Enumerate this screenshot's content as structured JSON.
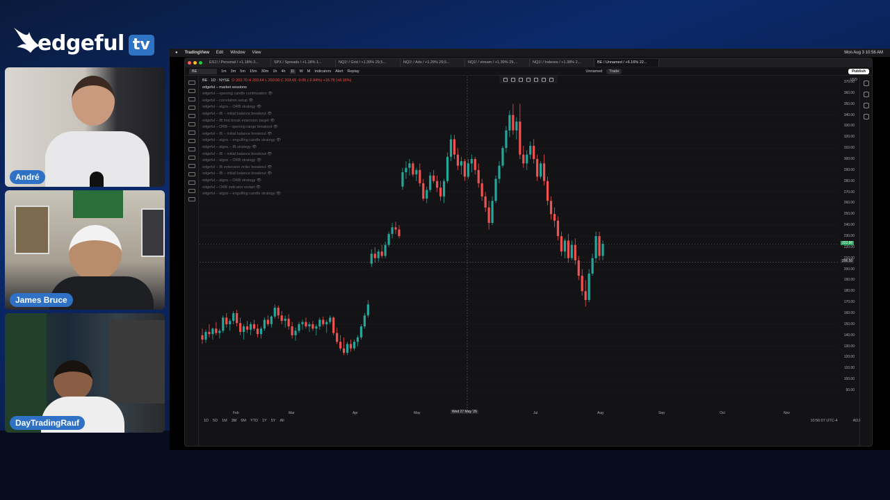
{
  "brand": {
    "word": "edgeful",
    "tv": "tv"
  },
  "participants": [
    {
      "name": "André"
    },
    {
      "name": "James Bruce"
    },
    {
      "name": "DayTradingRauf"
    }
  ],
  "mac_menu": {
    "app": "TradingView",
    "items": [
      "Edit",
      "Window",
      "View"
    ],
    "clock": "Mon Aug 3 10:56 AM"
  },
  "tabs": [
    {
      "label": "ES1! / Personal / +1.18% 3..."
    },
    {
      "label": "SPX / Spreads / +1.18% 1..."
    },
    {
      "label": "NQ1! / Grid / +1.39% 29,5..."
    },
    {
      "label": "NQ1! / Ads / +1.29% 29,5..."
    },
    {
      "label": "NQ1! / stream / +1.39% 29,..."
    },
    {
      "label": "NQ1! / Indexes / +1.38% 2..."
    },
    {
      "label": "BE / Unnamed / +6.16% 22..."
    }
  ],
  "toolbar": {
    "symbol": "BE",
    "intervals": [
      "1m",
      "3m",
      "5m",
      "15m",
      "30m",
      "1h",
      "4h",
      "D",
      "W",
      "M"
    ],
    "indicators": "Indicators",
    "alert": "Alert",
    "replay": "Replay",
    "layout": "Unnamed",
    "trade": "Trade",
    "publish": "Publish"
  },
  "legend": {
    "title": "BE · 1D · NYSE",
    "ohlc": "O 203.70  H 203.64  L 203.00  C 203.65  -0.05 (-2.94%)  +16.78 (+8.16%)",
    "first": "edgeful – market sessions",
    "indicators": [
      "edgeful – opening candle continuation",
      "edgeful – correlation setup",
      "edgeful – algos – ORB strategy",
      "edgeful – IB – initial balance breakout",
      "edgeful – IB first break extension target",
      "edgeful – ORB – opening range breakout",
      "edgeful – IB – initial balance breakout",
      "edgeful – algos – engulfing candle strategy",
      "edgeful – algos – IB strategy",
      "edgeful – IB – initial balance breakout",
      "edgeful – algos – ORB strategy",
      "edgeful – IB extension order breakout",
      "edgeful – IB – initial balance breakout",
      "edgeful – algos – ORB strategy",
      "edgeful – ORB indicator restart",
      "edgeful – algos – engulfing candle strategy"
    ]
  },
  "price_axis": {
    "currency": "USD",
    "ticks": [
      "370.00",
      "360.00",
      "350.00",
      "340.00",
      "330.00",
      "320.00",
      "310.00",
      "300.00",
      "290.00",
      "280.00",
      "270.00",
      "260.00",
      "250.00",
      "240.00",
      "230.00",
      "220.00",
      "210.00",
      "200.00",
      "190.00",
      "180.00",
      "170.00",
      "160.00",
      "150.00",
      "140.00",
      "130.00",
      "120.00",
      "110.00",
      "100.00",
      "90.00"
    ],
    "last_price": "222.80",
    "crosshair_price": "206.50"
  },
  "time_axis": {
    "ticks": [
      "Feb",
      "Mar",
      "Apr",
      "May",
      "Jul",
      "Aug",
      "Sep",
      "Oct",
      "Nov"
    ],
    "crosshair_date": "Wed 27 May '26"
  },
  "range_bar": {
    "ranges": [
      "1D",
      "5D",
      "1M",
      "3M",
      "6M",
      "YTD",
      "1Y",
      "5Y",
      "All"
    ],
    "clock": "10:56:07 UTC-4",
    "adj": "ADJ"
  },
  "chart_data": {
    "type": "candlestick",
    "ylim": [
      90,
      370
    ],
    "candles": [
      {
        "o": 140,
        "h": 146,
        "l": 132,
        "c": 136
      },
      {
        "o": 136,
        "h": 145,
        "l": 133,
        "c": 143
      },
      {
        "o": 143,
        "h": 150,
        "l": 138,
        "c": 141
      },
      {
        "o": 141,
        "h": 147,
        "l": 136,
        "c": 146
      },
      {
        "o": 146,
        "h": 152,
        "l": 140,
        "c": 142
      },
      {
        "o": 142,
        "h": 146,
        "l": 137,
        "c": 144
      },
      {
        "o": 144,
        "h": 158,
        "l": 142,
        "c": 156
      },
      {
        "o": 156,
        "h": 160,
        "l": 147,
        "c": 150
      },
      {
        "o": 150,
        "h": 155,
        "l": 144,
        "c": 153
      },
      {
        "o": 153,
        "h": 162,
        "l": 150,
        "c": 160
      },
      {
        "o": 160,
        "h": 163,
        "l": 148,
        "c": 151
      },
      {
        "o": 151,
        "h": 156,
        "l": 140,
        "c": 143
      },
      {
        "o": 143,
        "h": 150,
        "l": 136,
        "c": 148
      },
      {
        "o": 148,
        "h": 153,
        "l": 142,
        "c": 145
      },
      {
        "o": 145,
        "h": 152,
        "l": 140,
        "c": 150
      },
      {
        "o": 150,
        "h": 154,
        "l": 144,
        "c": 146
      },
      {
        "o": 146,
        "h": 150,
        "l": 138,
        "c": 141
      },
      {
        "o": 141,
        "h": 148,
        "l": 137,
        "c": 146
      },
      {
        "o": 146,
        "h": 156,
        "l": 144,
        "c": 154
      },
      {
        "o": 154,
        "h": 158,
        "l": 148,
        "c": 150
      },
      {
        "o": 150,
        "h": 158,
        "l": 147,
        "c": 157
      },
      {
        "o": 157,
        "h": 168,
        "l": 155,
        "c": 165
      },
      {
        "o": 165,
        "h": 167,
        "l": 155,
        "c": 158
      },
      {
        "o": 158,
        "h": 162,
        "l": 150,
        "c": 153
      },
      {
        "o": 153,
        "h": 158,
        "l": 147,
        "c": 155
      },
      {
        "o": 155,
        "h": 159,
        "l": 145,
        "c": 148
      },
      {
        "o": 148,
        "h": 152,
        "l": 137,
        "c": 140
      },
      {
        "o": 140,
        "h": 147,
        "l": 135,
        "c": 144
      },
      {
        "o": 144,
        "h": 152,
        "l": 142,
        "c": 150
      },
      {
        "o": 150,
        "h": 154,
        "l": 145,
        "c": 152
      },
      {
        "o": 152,
        "h": 156,
        "l": 146,
        "c": 148
      },
      {
        "o": 148,
        "h": 152,
        "l": 143,
        "c": 150
      },
      {
        "o": 150,
        "h": 153,
        "l": 144,
        "c": 146
      },
      {
        "o": 146,
        "h": 150,
        "l": 140,
        "c": 148
      },
      {
        "o": 148,
        "h": 156,
        "l": 145,
        "c": 154
      },
      {
        "o": 154,
        "h": 157,
        "l": 148,
        "c": 150
      },
      {
        "o": 150,
        "h": 154,
        "l": 142,
        "c": 152
      },
      {
        "o": 152,
        "h": 158,
        "l": 150,
        "c": 156
      },
      {
        "o": 156,
        "h": 157,
        "l": 140,
        "c": 142
      },
      {
        "o": 142,
        "h": 147,
        "l": 132,
        "c": 134
      },
      {
        "o": 134,
        "h": 140,
        "l": 126,
        "c": 128
      },
      {
        "o": 128,
        "h": 138,
        "l": 122,
        "c": 124
      },
      {
        "o": 124,
        "h": 134,
        "l": 122,
        "c": 132
      },
      {
        "o": 132,
        "h": 136,
        "l": 125,
        "c": 128
      },
      {
        "o": 128,
        "h": 136,
        "l": 126,
        "c": 134
      },
      {
        "o": 134,
        "h": 140,
        "l": 130,
        "c": 138
      },
      {
        "o": 138,
        "h": 150,
        "l": 136,
        "c": 148
      },
      {
        "o": 148,
        "h": 160,
        "l": 146,
        "c": 158
      },
      {
        "o": 158,
        "h": 172,
        "l": 156,
        "c": 168
      },
      {
        "o": 205,
        "h": 218,
        "l": 202,
        "c": 214
      },
      {
        "o": 214,
        "h": 220,
        "l": 206,
        "c": 210
      },
      {
        "o": 210,
        "h": 218,
        "l": 207,
        "c": 216
      },
      {
        "o": 216,
        "h": 222,
        "l": 210,
        "c": 212
      },
      {
        "o": 212,
        "h": 225,
        "l": 210,
        "c": 222
      },
      {
        "o": 222,
        "h": 234,
        "l": 220,
        "c": 232
      },
      {
        "o": 232,
        "h": 242,
        "l": 228,
        "c": 238
      },
      {
        "o": 238,
        "h": 243,
        "l": 232,
        "c": 236
      },
      {
        "o": 236,
        "h": 240,
        "l": 228,
        "c": 230
      },
      {
        "o": 275,
        "h": 292,
        "l": 272,
        "c": 288
      },
      {
        "o": 288,
        "h": 298,
        "l": 282,
        "c": 292
      },
      {
        "o": 292,
        "h": 300,
        "l": 285,
        "c": 296
      },
      {
        "o": 296,
        "h": 298,
        "l": 284,
        "c": 286
      },
      {
        "o": 286,
        "h": 292,
        "l": 280,
        "c": 290
      },
      {
        "o": 290,
        "h": 296,
        "l": 275,
        "c": 278
      },
      {
        "o": 278,
        "h": 282,
        "l": 262,
        "c": 264
      },
      {
        "o": 264,
        "h": 275,
        "l": 260,
        "c": 272
      },
      {
        "o": 272,
        "h": 288,
        "l": 270,
        "c": 285
      },
      {
        "o": 285,
        "h": 290,
        "l": 278,
        "c": 280
      },
      {
        "o": 280,
        "h": 285,
        "l": 270,
        "c": 274
      },
      {
        "o": 274,
        "h": 280,
        "l": 262,
        "c": 266
      },
      {
        "o": 266,
        "h": 282,
        "l": 260,
        "c": 280
      },
      {
        "o": 280,
        "h": 306,
        "l": 278,
        "c": 302
      },
      {
        "o": 302,
        "h": 322,
        "l": 298,
        "c": 318
      },
      {
        "o": 318,
        "h": 322,
        "l": 300,
        "c": 304
      },
      {
        "o": 304,
        "h": 310,
        "l": 290,
        "c": 294
      },
      {
        "o": 294,
        "h": 302,
        "l": 286,
        "c": 298
      },
      {
        "o": 298,
        "h": 300,
        "l": 280,
        "c": 284
      },
      {
        "o": 284,
        "h": 300,
        "l": 282,
        "c": 296
      },
      {
        "o": 296,
        "h": 304,
        "l": 288,
        "c": 300
      },
      {
        "o": 300,
        "h": 302,
        "l": 286,
        "c": 290
      },
      {
        "o": 290,
        "h": 296,
        "l": 274,
        "c": 278
      },
      {
        "o": 278,
        "h": 282,
        "l": 262,
        "c": 266
      },
      {
        "o": 266,
        "h": 270,
        "l": 252,
        "c": 256
      },
      {
        "o": 256,
        "h": 262,
        "l": 236,
        "c": 242
      },
      {
        "o": 242,
        "h": 266,
        "l": 240,
        "c": 262
      },
      {
        "o": 262,
        "h": 285,
        "l": 260,
        "c": 282
      },
      {
        "o": 282,
        "h": 298,
        "l": 278,
        "c": 294
      },
      {
        "o": 294,
        "h": 312,
        "l": 292,
        "c": 310
      },
      {
        "o": 310,
        "h": 330,
        "l": 306,
        "c": 326
      },
      {
        "o": 326,
        "h": 344,
        "l": 320,
        "c": 340
      },
      {
        "o": 340,
        "h": 350,
        "l": 322,
        "c": 326
      },
      {
        "o": 326,
        "h": 338,
        "l": 318,
        "c": 334
      },
      {
        "o": 334,
        "h": 350,
        "l": 300,
        "c": 304
      },
      {
        "o": 304,
        "h": 312,
        "l": 292,
        "c": 296
      },
      {
        "o": 296,
        "h": 308,
        "l": 290,
        "c": 304
      },
      {
        "o": 304,
        "h": 316,
        "l": 300,
        "c": 312
      },
      {
        "o": 312,
        "h": 318,
        "l": 296,
        "c": 300
      },
      {
        "o": 300,
        "h": 304,
        "l": 280,
        "c": 284
      },
      {
        "o": 284,
        "h": 298,
        "l": 282,
        "c": 296
      },
      {
        "o": 296,
        "h": 304,
        "l": 276,
        "c": 280
      },
      {
        "o": 280,
        "h": 284,
        "l": 258,
        "c": 262
      },
      {
        "o": 262,
        "h": 266,
        "l": 245,
        "c": 250
      },
      {
        "o": 250,
        "h": 256,
        "l": 238,
        "c": 244
      },
      {
        "o": 244,
        "h": 248,
        "l": 226,
        "c": 230
      },
      {
        "o": 230,
        "h": 234,
        "l": 212,
        "c": 216
      },
      {
        "o": 216,
        "h": 228,
        "l": 210,
        "c": 226
      },
      {
        "o": 226,
        "h": 232,
        "l": 206,
        "c": 210
      },
      {
        "o": 210,
        "h": 226,
        "l": 208,
        "c": 222
      },
      {
        "o": 222,
        "h": 228,
        "l": 204,
        "c": 208
      },
      {
        "o": 208,
        "h": 212,
        "l": 190,
        "c": 194
      },
      {
        "o": 194,
        "h": 200,
        "l": 176,
        "c": 180
      },
      {
        "o": 180,
        "h": 190,
        "l": 166,
        "c": 172
      },
      {
        "o": 172,
        "h": 200,
        "l": 170,
        "c": 196
      },
      {
        "o": 196,
        "h": 214,
        "l": 194,
        "c": 210
      },
      {
        "o": 210,
        "h": 234,
        "l": 206,
        "c": 230
      },
      {
        "o": 230,
        "h": 234,
        "l": 208,
        "c": 212
      },
      {
        "o": 212,
        "h": 226,
        "l": 208,
        "c": 223
      }
    ],
    "last": 222.8,
    "crosshair": 206.5
  },
  "colors": {
    "up": "#26a69a",
    "down": "#ef5350",
    "accent": "#2f73c4"
  }
}
